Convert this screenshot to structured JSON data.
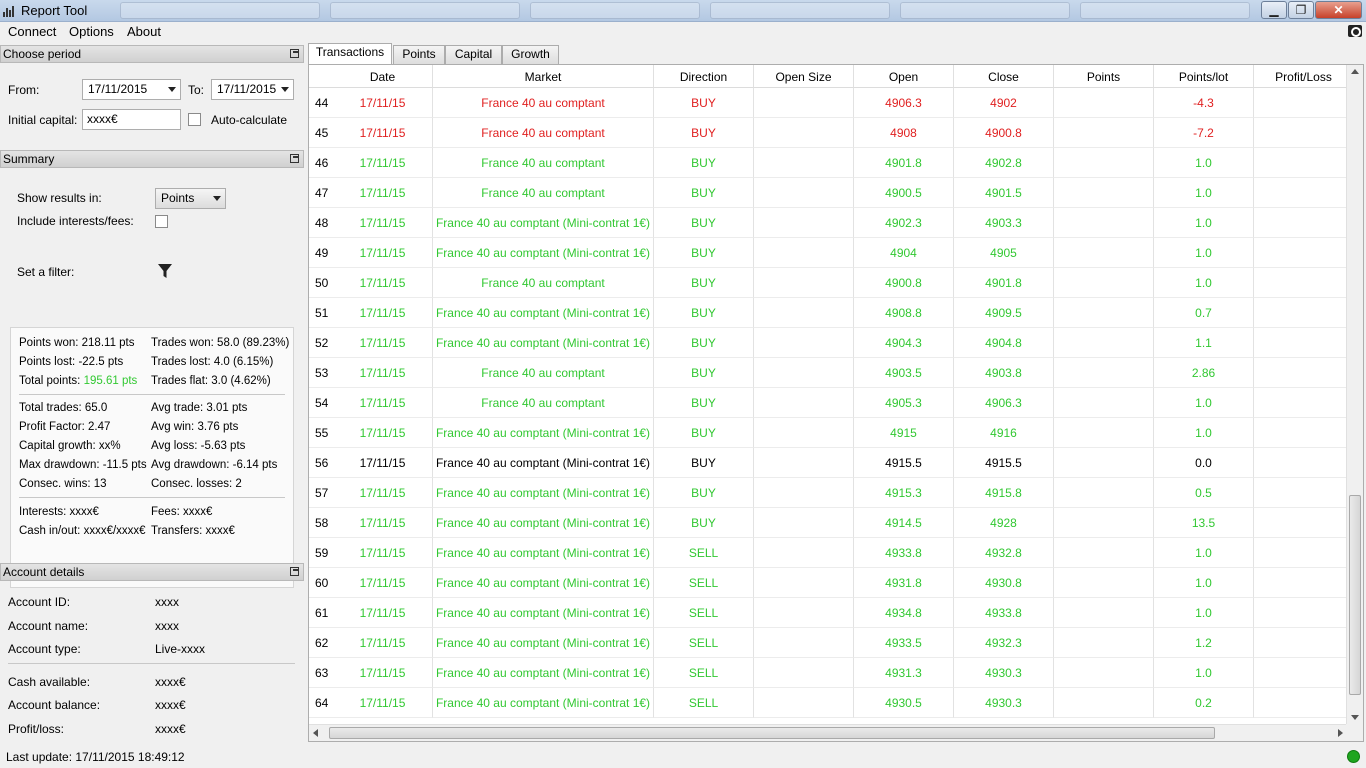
{
  "window": {
    "title": "Report Tool",
    "minimize_label": "▁",
    "maximize_label": "❐",
    "close_label": "✕"
  },
  "menu": {
    "connect": "Connect",
    "options": "Options",
    "about": "About"
  },
  "period": {
    "header": "Choose period",
    "from_label": "From:",
    "from_value": "17/11/2015",
    "to_label": "To:",
    "to_value": "17/11/2015",
    "capital_label": "Initial capital:",
    "capital_value": "xxxx€",
    "auto_label": "Auto-calculate"
  },
  "summary": {
    "header": "Summary",
    "show_results_label": "Show results in:",
    "show_results_value": "Points",
    "interests_label": "Include interests/fees:",
    "filter_label": "Set a filter:",
    "stats": {
      "points_won": "Points won: 218.11 pts",
      "trades_won": "Trades won: 58.0 (89.23%)",
      "points_lost": "Points lost: -22.5 pts",
      "trades_lost": "Trades lost: 4.0 (6.15%)",
      "total_points_label": "Total points:",
      "total_points_value": "195.61 pts",
      "trades_flat": "Trades flat: 3.0 (4.62%)",
      "total_trades": "Total trades: 65.0",
      "avg_trade": "Avg trade: 3.01 pts",
      "profit_factor": "Profit Factor: 2.47",
      "avg_win": "Avg win: 3.76 pts",
      "capital_growth": "Capital growth: xx%",
      "avg_loss": "Avg loss: -5.63 pts",
      "max_drawdown": "Max drawdown: -11.5 pts",
      "avg_drawdown": "Avg drawdown: -6.14 pts",
      "consec_wins": "Consec. wins: 13",
      "consec_losses": "Consec. losses: 2",
      "interests": "Interests: xxxx€",
      "fees": "Fees: xxxx€",
      "cash_inout": "Cash in/out: xxxx€/xxxx€",
      "transfers": "Transfers: xxxx€"
    }
  },
  "account": {
    "header": "Account details",
    "id_label": "Account ID:",
    "id_value": "xxxx",
    "name_label": "Account name:",
    "name_value": "xxxx",
    "type_label": "Account type:",
    "type_value": "Live-xxxx",
    "cash_label": "Cash available:",
    "cash_value": "xxxx€",
    "balance_label": "Account balance:",
    "balance_value": "xxxx€",
    "pl_label": "Profit/loss:",
    "pl_value": "xxxx€"
  },
  "status": {
    "last_update": "Last update: 17/11/2015 18:49:12",
    "connection_color": "#1fa51f"
  },
  "tabs": [
    "Transactions",
    "Points",
    "Capital",
    "Growth"
  ],
  "table": {
    "columns": [
      "Date",
      "Market",
      "Direction",
      "Open Size",
      "Open",
      "Close",
      "Points",
      "Points/lot",
      "Profit/Loss"
    ],
    "colors": {
      "green": "#32c832",
      "red": "#e02020",
      "black": "#000000"
    },
    "rows": [
      {
        "n": "44",
        "date": "17/11/15",
        "market": "France 40 au comptant",
        "direction": "BUY",
        "open": "4906.3",
        "close": "4902",
        "ppl": "-4.3",
        "color": "red"
      },
      {
        "n": "45",
        "date": "17/11/15",
        "market": "France 40 au comptant",
        "direction": "BUY",
        "open": "4908",
        "close": "4900.8",
        "ppl": "-7.2",
        "color": "red"
      },
      {
        "n": "46",
        "date": "17/11/15",
        "market": "France 40 au comptant",
        "direction": "BUY",
        "open": "4901.8",
        "close": "4902.8",
        "ppl": "1.0",
        "color": "green"
      },
      {
        "n": "47",
        "date": "17/11/15",
        "market": "France 40 au comptant",
        "direction": "BUY",
        "open": "4900.5",
        "close": "4901.5",
        "ppl": "1.0",
        "color": "green"
      },
      {
        "n": "48",
        "date": "17/11/15",
        "market": "France 40 au comptant (Mini-contrat 1€)",
        "direction": "BUY",
        "open": "4902.3",
        "close": "4903.3",
        "ppl": "1.0",
        "color": "green"
      },
      {
        "n": "49",
        "date": "17/11/15",
        "market": "France 40 au comptant (Mini-contrat 1€)",
        "direction": "BUY",
        "open": "4904",
        "close": "4905",
        "ppl": "1.0",
        "color": "green"
      },
      {
        "n": "50",
        "date": "17/11/15",
        "market": "France 40 au comptant",
        "direction": "BUY",
        "open": "4900.8",
        "close": "4901.8",
        "ppl": "1.0",
        "color": "green"
      },
      {
        "n": "51",
        "date": "17/11/15",
        "market": "France 40 au comptant (Mini-contrat 1€)",
        "direction": "BUY",
        "open": "4908.8",
        "close": "4909.5",
        "ppl": "0.7",
        "color": "green"
      },
      {
        "n": "52",
        "date": "17/11/15",
        "market": "France 40 au comptant (Mini-contrat 1€)",
        "direction": "BUY",
        "open": "4904.3",
        "close": "4904.8",
        "ppl": "1.1",
        "color": "green"
      },
      {
        "n": "53",
        "date": "17/11/15",
        "market": "France 40 au comptant",
        "direction": "BUY",
        "open": "4903.5",
        "close": "4903.8",
        "ppl": "2.86",
        "color": "green"
      },
      {
        "n": "54",
        "date": "17/11/15",
        "market": "France 40 au comptant",
        "direction": "BUY",
        "open": "4905.3",
        "close": "4906.3",
        "ppl": "1.0",
        "color": "green"
      },
      {
        "n": "55",
        "date": "17/11/15",
        "market": "France 40 au comptant (Mini-contrat 1€)",
        "direction": "BUY",
        "open": "4915",
        "close": "4916",
        "ppl": "1.0",
        "color": "green"
      },
      {
        "n": "56",
        "date": "17/11/15",
        "market": "France 40 au comptant (Mini-contrat 1€)",
        "direction": "BUY",
        "open": "4915.5",
        "close": "4915.5",
        "ppl": "0.0",
        "color": "black"
      },
      {
        "n": "57",
        "date": "17/11/15",
        "market": "France 40 au comptant (Mini-contrat 1€)",
        "direction": "BUY",
        "open": "4915.3",
        "close": "4915.8",
        "ppl": "0.5",
        "color": "green"
      },
      {
        "n": "58",
        "date": "17/11/15",
        "market": "France 40 au comptant (Mini-contrat 1€)",
        "direction": "BUY",
        "open": "4914.5",
        "close": "4928",
        "ppl": "13.5",
        "color": "green"
      },
      {
        "n": "59",
        "date": "17/11/15",
        "market": "France 40 au comptant (Mini-contrat 1€)",
        "direction": "SELL",
        "open": "4933.8",
        "close": "4932.8",
        "ppl": "1.0",
        "color": "green"
      },
      {
        "n": "60",
        "date": "17/11/15",
        "market": "France 40 au comptant (Mini-contrat 1€)",
        "direction": "SELL",
        "open": "4931.8",
        "close": "4930.8",
        "ppl": "1.0",
        "color": "green"
      },
      {
        "n": "61",
        "date": "17/11/15",
        "market": "France 40 au comptant (Mini-contrat 1€)",
        "direction": "SELL",
        "open": "4934.8",
        "close": "4933.8",
        "ppl": "1.0",
        "color": "green"
      },
      {
        "n": "62",
        "date": "17/11/15",
        "market": "France 40 au comptant (Mini-contrat 1€)",
        "direction": "SELL",
        "open": "4933.5",
        "close": "4932.3",
        "ppl": "1.2",
        "color": "green"
      },
      {
        "n": "63",
        "date": "17/11/15",
        "market": "France 40 au comptant (Mini-contrat 1€)",
        "direction": "SELL",
        "open": "4931.3",
        "close": "4930.3",
        "ppl": "1.0",
        "color": "green"
      },
      {
        "n": "64",
        "date": "17/11/15",
        "market": "France 40 au comptant (Mini-contrat 1€)",
        "direction": "SELL",
        "open": "4930.5",
        "close": "4930.3",
        "ppl": "0.2",
        "color": "green"
      }
    ]
  }
}
